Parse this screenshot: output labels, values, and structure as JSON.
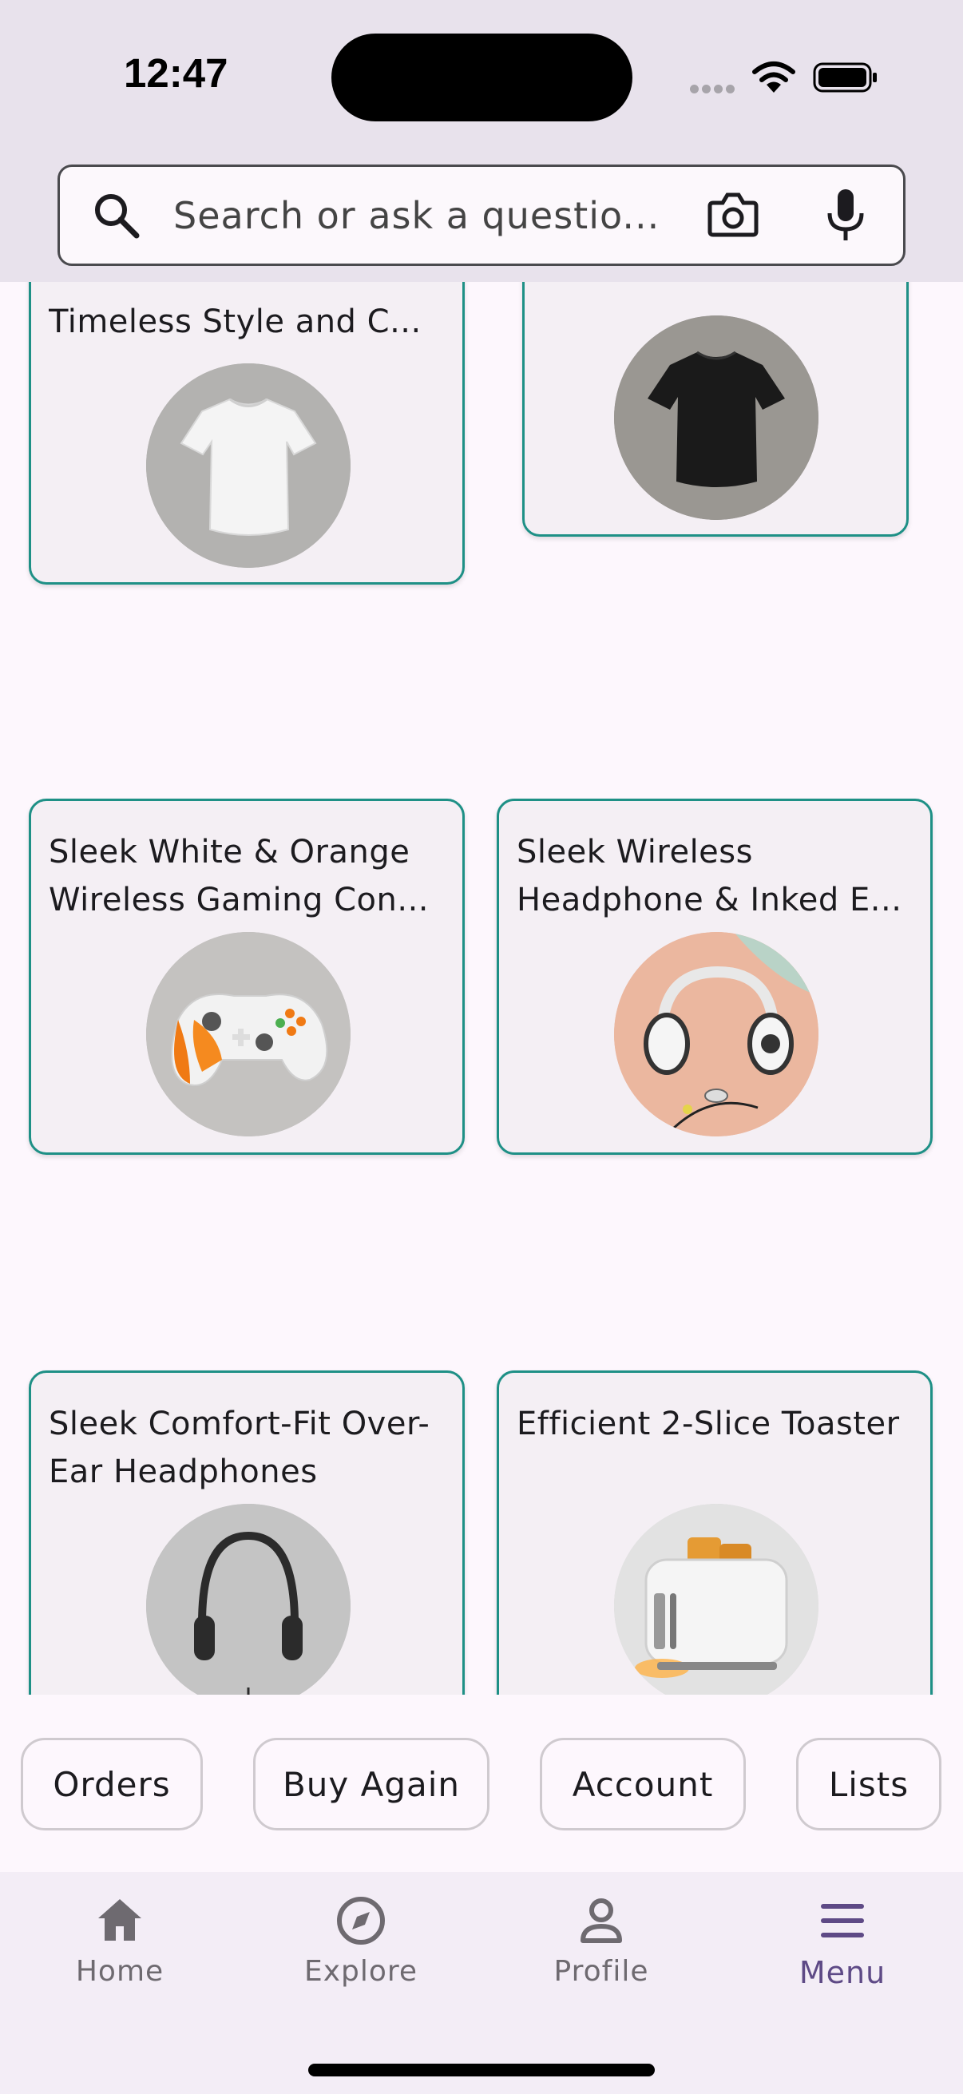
{
  "status_bar": {
    "time": "12:47"
  },
  "search": {
    "placeholder": "Search or ask a questio..."
  },
  "products": [
    {
      "title": "Timeless Style and C...",
      "image": "white-tshirt"
    },
    {
      "title": "",
      "image": "black-tshirt"
    },
    {
      "title": "Sleek White & Orange Wireless Gaming Con...",
      "image": "game-controller"
    },
    {
      "title": "Sleek Wireless Headphone & Inked E...",
      "image": "headphones-earbuds"
    },
    {
      "title": "Sleek Comfort-Fit Over-Ear Headphones",
      "image": "over-ear-headphones"
    },
    {
      "title": "Efficient 2-Slice Toaster",
      "image": "toaster"
    }
  ],
  "quick_links": [
    "Orders",
    "Buy Again",
    "Account",
    "Lists"
  ],
  "nav": {
    "items": [
      {
        "label": "Home",
        "icon": "home-icon"
      },
      {
        "label": "Explore",
        "icon": "compass-icon"
      },
      {
        "label": "Profile",
        "icon": "person-icon"
      },
      {
        "label": "Menu",
        "icon": "menu-icon"
      }
    ],
    "active": "Menu"
  },
  "colors": {
    "card_border": "#1e9086",
    "card_bg": "#f4eff4",
    "page_bg": "#fdf7fd",
    "header_bg": "#e8e2ec",
    "nav_active": "#5e4a86"
  }
}
